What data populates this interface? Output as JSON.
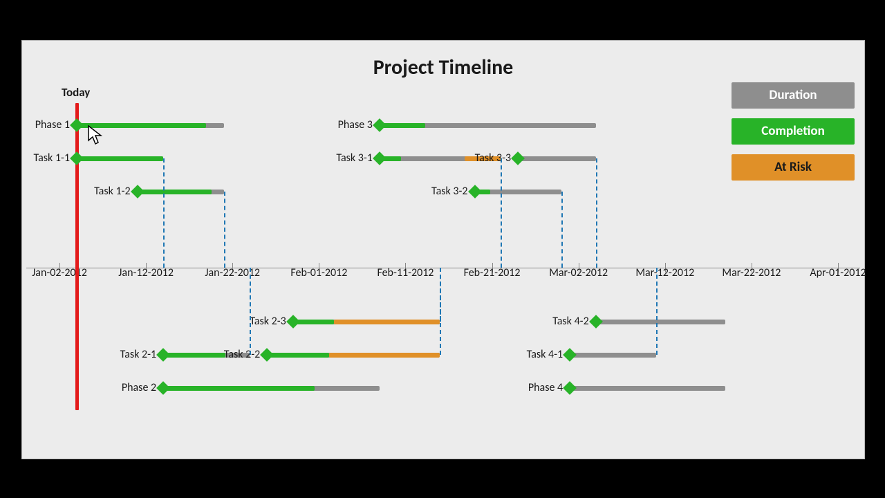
{
  "title": "Project Timeline",
  "today_label": "Today",
  "legend": {
    "duration": "Duration",
    "completion": "Completion",
    "atrisk": "At Risk"
  },
  "axis_ticks": [
    "Jan-02-2012",
    "Jan-12-2012",
    "Jan-22-2012",
    "Feb-01-2012",
    "Feb-11-2012",
    "Feb-21-2012",
    "Mar-02-2012",
    "Mar-12-2012",
    "Mar-22-2012",
    "Apr-01-2012"
  ],
  "chart_data": {
    "type": "bar",
    "title": "Project Timeline",
    "xlabel": "",
    "ylabel": "",
    "xlim": [
      "Jan-02-2012",
      "Apr-01-2012"
    ],
    "today": "Jan-04-2012",
    "legend": [
      "Duration",
      "Completion",
      "At Risk"
    ],
    "tasks": [
      {
        "name": "Phase 1",
        "start": "Jan-04-2012",
        "end": "Jan-21-2012",
        "completion_pct": 88,
        "atrisk_pct": 0,
        "above_axis": true
      },
      {
        "name": "Task 1-1",
        "start": "Jan-04-2012",
        "end": "Jan-14-2012",
        "completion_pct": 100,
        "atrisk_pct": 0,
        "above_axis": true
      },
      {
        "name": "Task 1-2",
        "start": "Jan-11-2012",
        "end": "Jan-21-2012",
        "completion_pct": 86,
        "atrisk_pct": 0,
        "above_axis": true
      },
      {
        "name": "Phase 3",
        "start": "Feb-08-2012",
        "end": "Mar-04-2012",
        "completion_pct": 21,
        "atrisk_pct": 0,
        "above_axis": true
      },
      {
        "name": "Task 3-1",
        "start": "Feb-08-2012",
        "end": "Feb-22-2012",
        "completion_pct": 18,
        "atrisk_pct": 30,
        "above_axis": true
      },
      {
        "name": "Task 3-2",
        "start": "Feb-19-2012",
        "end": "Feb-29-2012",
        "completion_pct": 18,
        "atrisk_pct": 0,
        "above_axis": true
      },
      {
        "name": "Task 3-3",
        "start": "Feb-24-2012",
        "end": "Mar-04-2012",
        "completion_pct": 0,
        "atrisk_pct": 0,
        "above_axis": true
      },
      {
        "name": "Phase 2",
        "start": "Jan-14-2012",
        "end": "Feb-08-2012",
        "completion_pct": 70,
        "atrisk_pct": 0,
        "above_axis": false
      },
      {
        "name": "Task 2-1",
        "start": "Jan-14-2012",
        "end": "Jan-24-2012",
        "completion_pct": 72,
        "atrisk_pct": 0,
        "above_axis": false
      },
      {
        "name": "Task 2-2",
        "start": "Jan-26-2012",
        "end": "Feb-15-2012",
        "completion_pct": 36,
        "atrisk_pct": 64,
        "above_axis": false
      },
      {
        "name": "Task 2-3",
        "start": "Jan-29-2012",
        "end": "Feb-15-2012",
        "completion_pct": 28,
        "atrisk_pct": 72,
        "above_axis": false
      },
      {
        "name": "Phase 4",
        "start": "Mar-01-2012",
        "end": "Mar-19-2012",
        "completion_pct": 0,
        "atrisk_pct": 0,
        "above_axis": false
      },
      {
        "name": "Task 4-1",
        "start": "Mar-01-2012",
        "end": "Mar-11-2012",
        "completion_pct": 0,
        "atrisk_pct": 0,
        "above_axis": false
      },
      {
        "name": "Task 4-2",
        "start": "Mar-04-2012",
        "end": "Mar-19-2012",
        "completion_pct": 0,
        "atrisk_pct": 0,
        "above_axis": false
      }
    ],
    "dependencies": [
      [
        "Task 1-1",
        "Task 1-2"
      ],
      [
        "Task 1-2",
        "Phase 2"
      ],
      [
        "Task 2-1",
        "Task 2-2"
      ],
      [
        "Task 2-2",
        "Task 2-3"
      ],
      [
        "Task 2-3",
        "Phase 3"
      ],
      [
        "Task 3-1",
        "Task 3-2"
      ],
      [
        "Task 3-2",
        "Task 3-3"
      ],
      [
        "Task 3-3",
        "Phase 4"
      ],
      [
        "Task 4-1",
        "Task 4-2"
      ]
    ]
  }
}
